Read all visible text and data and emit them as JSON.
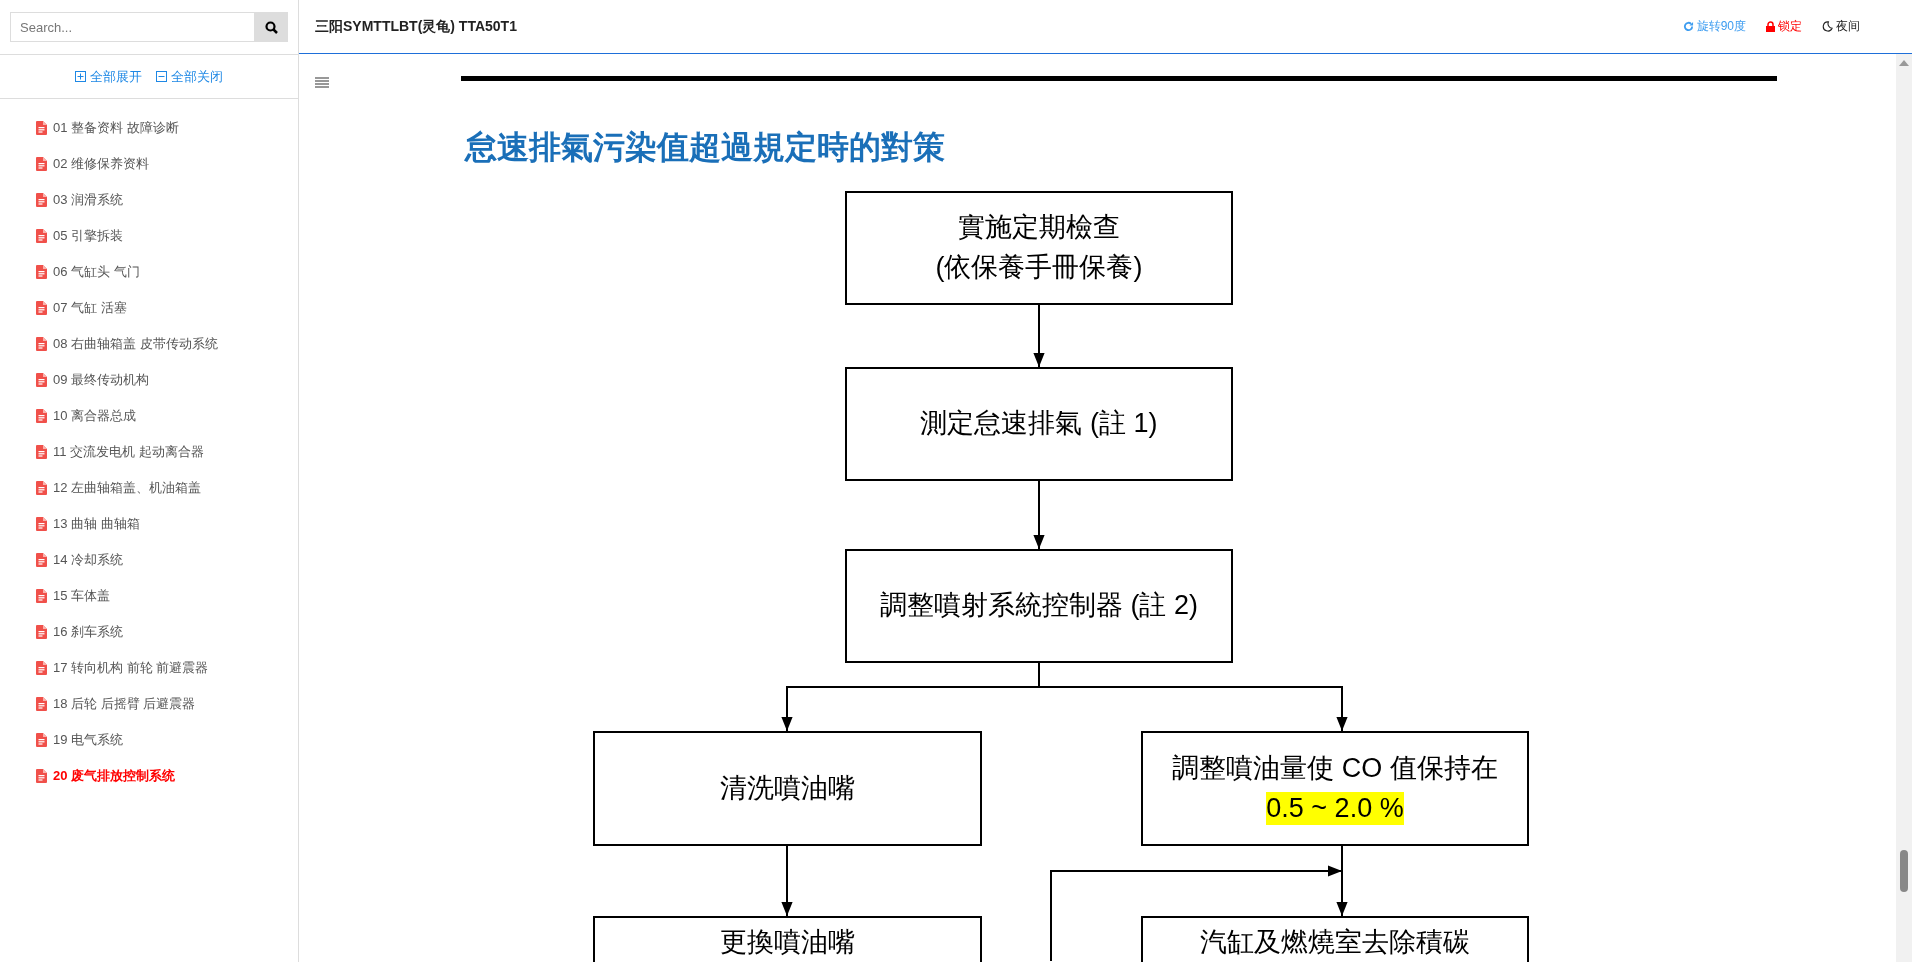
{
  "header": {
    "title": "三阳SYMTTLBT(灵龟) TTA50T1",
    "actions": [
      {
        "label": "旋转90度",
        "kind": "rotate"
      },
      {
        "label": "锁定",
        "kind": "lock"
      },
      {
        "label": "夜间",
        "kind": "night"
      }
    ]
  },
  "sidebar": {
    "search": {
      "placeholder": "Search..."
    },
    "expand_all": "全部展开",
    "collapse_all": "全部关闭",
    "items": [
      {
        "label": "01 整备资料 故障诊断",
        "selected": false
      },
      {
        "label": "02 维修保养资料",
        "selected": false
      },
      {
        "label": "03 润滑系统",
        "selected": false
      },
      {
        "label": "05 引擎拆装",
        "selected": false
      },
      {
        "label": "06 气缸头 气门",
        "selected": false
      },
      {
        "label": "07 气缸 活塞",
        "selected": false
      },
      {
        "label": "08 右曲轴箱盖 皮带传动系统",
        "selected": false
      },
      {
        "label": "09 最终传动机构",
        "selected": false
      },
      {
        "label": "10 离合器总成",
        "selected": false
      },
      {
        "label": "11 交流发电机 起动离合器",
        "selected": false
      },
      {
        "label": "12 左曲轴箱盖、机油箱盖",
        "selected": false
      },
      {
        "label": "13 曲轴 曲轴箱",
        "selected": false
      },
      {
        "label": "14 冷却系统",
        "selected": false
      },
      {
        "label": "15 车体盖",
        "selected": false
      },
      {
        "label": "16 刹车系统",
        "selected": false
      },
      {
        "label": "17 转向机构 前轮 前避震器",
        "selected": false
      },
      {
        "label": "18 后轮 后摇臂 后避震器",
        "selected": false
      },
      {
        "label": "19 电气系统",
        "selected": false
      },
      {
        "label": "20 废气排放控制系统",
        "selected": true
      }
    ]
  },
  "document": {
    "heading": "怠速排氣污染值超過規定時的對策",
    "flowchart": {
      "boxes": [
        {
          "lines": [
            {
              "text": "實施定期檢查",
              "highlighted": false
            },
            {
              "text": "(依保養手冊保養)",
              "highlighted": false
            }
          ]
        },
        {
          "lines": [
            {
              "text": "測定怠速排氣 (註 1)",
              "highlighted": false
            }
          ]
        },
        {
          "lines": [
            {
              "text": "調整噴射系統控制器 (註 2)",
              "highlighted": false
            }
          ]
        },
        {
          "lines": [
            {
              "text": "清洗噴油嘴",
              "highlighted": false
            }
          ]
        },
        {
          "lines": [
            {
              "text": "調整噴油量使 CO 值保持在",
              "highlighted": false
            },
            {
              "text": "0.5 ~ 2.0 %",
              "highlighted": true
            }
          ]
        },
        {
          "lines": [
            {
              "text": "更換噴油嘴",
              "highlighted": false
            }
          ]
        },
        {
          "lines": [
            {
              "text": "汽缸及燃燒室去除積碳",
              "highlighted": false
            }
          ]
        }
      ]
    }
  }
}
